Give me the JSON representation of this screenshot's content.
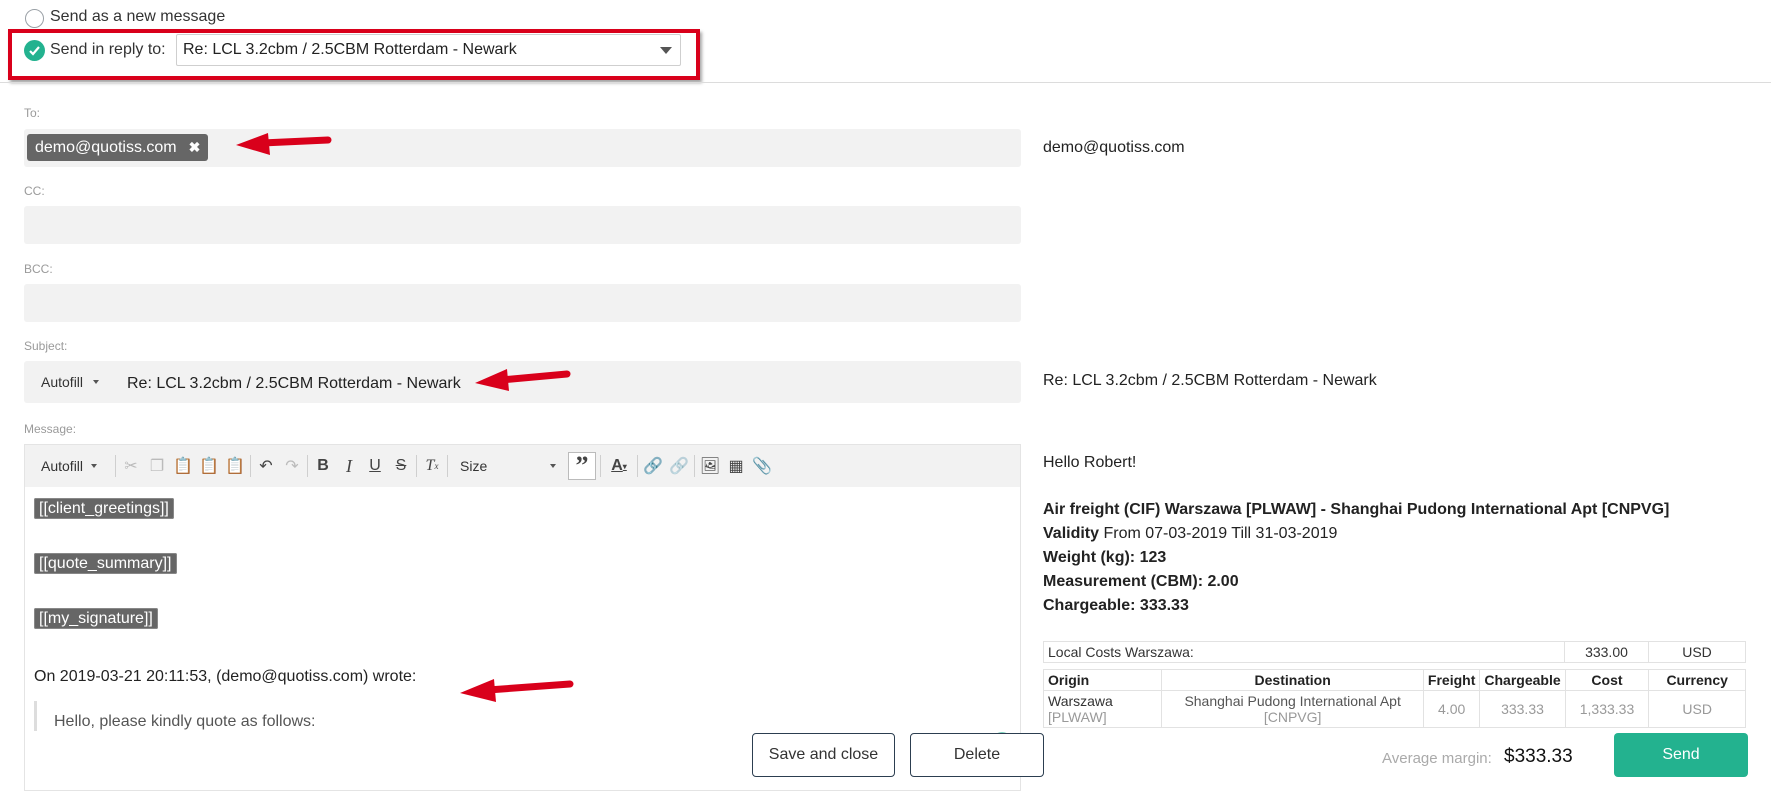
{
  "reply_mode": {
    "new_message_label": "Send as a new message",
    "reply_label": "Send in reply to:",
    "reply_select_value": "Re: LCL 3.2cbm / 2.5CBM Rotterdam - Newark"
  },
  "to": {
    "label": "To:",
    "tag": "demo@quotiss.com",
    "preview": "demo@quotiss.com"
  },
  "cc": {
    "label": "CC:"
  },
  "bcc": {
    "label": "BCC:"
  },
  "subject": {
    "label": "Subject:",
    "autofill_label": "Autofill",
    "value": "Re: LCL 3.2cbm / 2.5CBM Rotterdam - Newark",
    "preview": "Re: LCL 3.2cbm / 2.5CBM Rotterdam - Newark"
  },
  "message": {
    "label": "Message:",
    "toolbar": {
      "autofill_label": "Autofill",
      "size_label": "Size"
    },
    "placeholders": [
      "[[client_greetings]]",
      "[[quote_summary]]",
      "[[my_signature]]"
    ],
    "quote_header": "On 2019-03-21 20:11:53, (demo@quotiss.com) wrote:",
    "quote_text": "Hello, please kindly quote as follows:"
  },
  "preview": {
    "greeting": "Hello Robert!",
    "title": "Air freight (CIF) Warszawa [PLWAW] - Shanghai Pudong International Apt [CNPVG]",
    "validity_label": "Validity",
    "validity_value": "From 07-03-2019 Till 31-03-2019",
    "weight": "Weight (kg): 123",
    "measurement": "Measurement (CBM): 2.00",
    "chargeable": "Chargeable: 333.33",
    "local_costs": {
      "label": "Local Costs Warszawa:",
      "amount": "333.00",
      "currency": "USD"
    },
    "table": {
      "headers": [
        "Origin",
        "Destination",
        "Freight",
        "Chargeable",
        "Cost",
        "Currency"
      ],
      "row": {
        "origin": "Warszawa",
        "origin_code": "[PLWAW]",
        "destination": "Shanghai Pudong International Apt",
        "destination_code": "[CNPVG]",
        "freight": "4.00",
        "chargeable": "333.33",
        "cost": "1,333.33",
        "currency": "USD"
      }
    }
  },
  "footer": {
    "save_close": "Save and close",
    "delete": "Delete",
    "avg_margin_label": "Average margin:",
    "avg_margin_value": "$333.33",
    "send": "Send"
  },
  "colors": {
    "accent": "#23b28f",
    "highlight_red": "#d9001b",
    "tag_bg": "#666666"
  }
}
